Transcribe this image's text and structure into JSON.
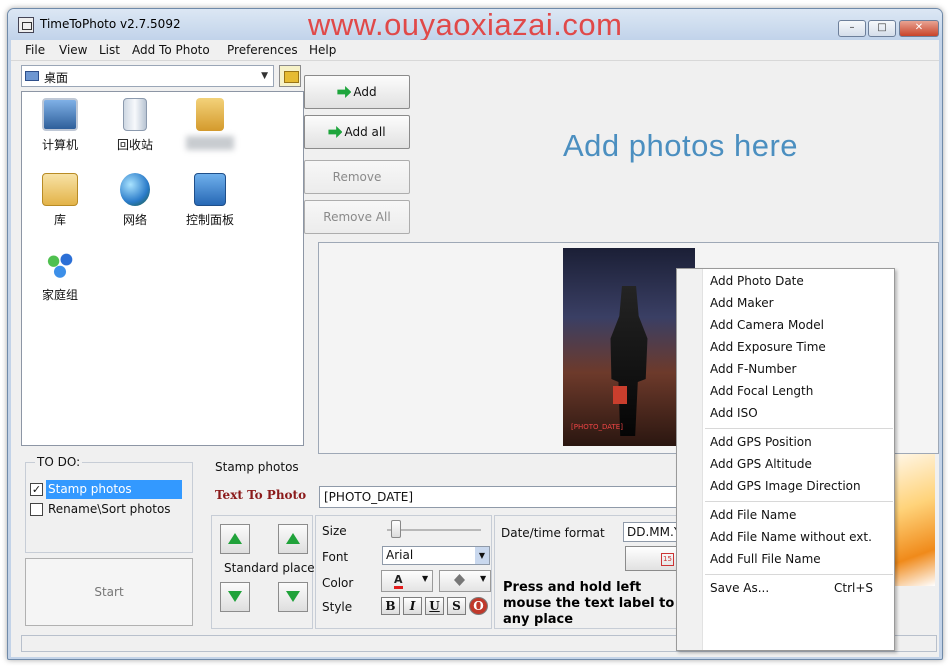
{
  "window": {
    "title": "TimeToPhoto v2.7.5092",
    "watermark": "www.ouyaoxiazai.com",
    "minimize_glyph": "–",
    "maximize_glyph": "□",
    "close_glyph": "✕"
  },
  "menu": [
    "File",
    "View",
    "List",
    "Add To Photo",
    "Preferences",
    "Help"
  ],
  "browser": {
    "location": "桌面",
    "items": [
      {
        "label": "计算机",
        "icon": "computer-icon"
      },
      {
        "label": "回收站",
        "icon": "recycle-bin-icon"
      },
      {
        "label": "",
        "icon": "user-folder-icon"
      },
      {
        "label": "库",
        "icon": "library-icon"
      },
      {
        "label": "网络",
        "icon": "network-icon"
      },
      {
        "label": "控制面板",
        "icon": "control-panel-icon"
      },
      {
        "label": "家庭组",
        "icon": "homegroup-icon"
      }
    ]
  },
  "actions": {
    "add": "Add",
    "add_all": "Add all",
    "remove": "Remove",
    "remove_all": "Remove All"
  },
  "drop_hint": "Add photos here",
  "context_menu": {
    "items": [
      "Add Photo Date",
      "Add Maker",
      "Add Camera Model",
      "Add Exposure Time",
      "Add F-Number",
      "Add Focal Length",
      "Add ISO",
      "Add GPS Position",
      "Add GPS Altitude",
      "Add GPS Image Direction",
      "Add File Name",
      "Add File Name without ext.",
      "Add Full File Name",
      "Save As..."
    ],
    "save_shortcut": "Ctrl+S"
  },
  "todo": {
    "legend": "TO DO:",
    "options": [
      {
        "label": "Stamp photos",
        "checked": true
      },
      {
        "label": "Rename\\Sort photos",
        "checked": false
      }
    ],
    "start": "Start"
  },
  "stamp": {
    "legend": "Stamp photos",
    "text_label": "Text To Photo",
    "text_value": "[PHOTO_DATE]",
    "standard_places": "Standard places",
    "size_label": "Size",
    "font_label": "Font",
    "font_value": "Arial",
    "color_label": "Color",
    "style_label": "Style",
    "style_buttons": [
      "B",
      "I",
      "U",
      "S",
      "O"
    ],
    "date_format_label": "Date/time format",
    "date_format_value": "DD.MM.YY",
    "hint": "Press and hold left mouse the text label to any place"
  }
}
